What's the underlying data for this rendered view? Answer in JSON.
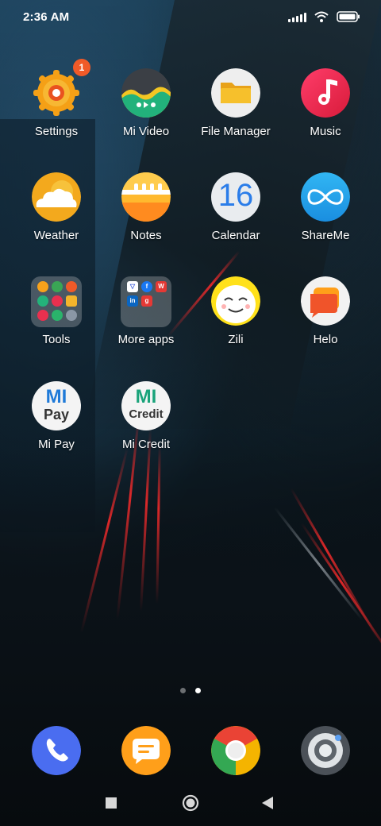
{
  "status_bar": {
    "time": "2:36 AM",
    "icons": [
      "signal-icon",
      "wifi-icon",
      "battery-icon"
    ]
  },
  "apps": [
    {
      "label": "Settings",
      "icon": "settings-icon",
      "badge": "1"
    },
    {
      "label": "Mi Video",
      "icon": "mi-video-icon"
    },
    {
      "label": "File Manager",
      "icon": "file-manager-icon"
    },
    {
      "label": "Music",
      "icon": "music-icon"
    },
    {
      "label": "Weather",
      "icon": "weather-icon"
    },
    {
      "label": "Notes",
      "icon": "notes-icon"
    },
    {
      "label": "Calendar",
      "icon": "calendar-icon",
      "icon_text": "16"
    },
    {
      "label": "ShareMe",
      "icon": "shareme-icon"
    },
    {
      "label": "Tools",
      "icon": "tools-folder-icon"
    },
    {
      "label": "More apps",
      "icon": "more-apps-folder-icon"
    },
    {
      "label": "Zili",
      "icon": "zili-icon"
    },
    {
      "label": "Helo",
      "icon": "helo-icon"
    },
    {
      "label": "Mi Pay",
      "icon": "mi-pay-icon",
      "icon_text_top": "MI",
      "icon_text_bottom": "Pay"
    },
    {
      "label": "Mi Credit",
      "icon": "mi-credit-icon",
      "icon_text_top": "MI",
      "icon_text_bottom": "Credit"
    }
  ],
  "page_indicator": {
    "pages": 2,
    "current": 2
  },
  "dock": [
    {
      "icon": "phone-icon"
    },
    {
      "icon": "messages-icon"
    },
    {
      "icon": "chrome-icon"
    },
    {
      "icon": "camera-icon"
    }
  ],
  "nav_bar": [
    "recents-button",
    "home-button",
    "back-button"
  ],
  "colors": {
    "badge": "#f05a28",
    "settings": "#f7a21b",
    "music": "#e8304f",
    "shareme": "#1e9be8",
    "phone": "#4a6df0"
  }
}
